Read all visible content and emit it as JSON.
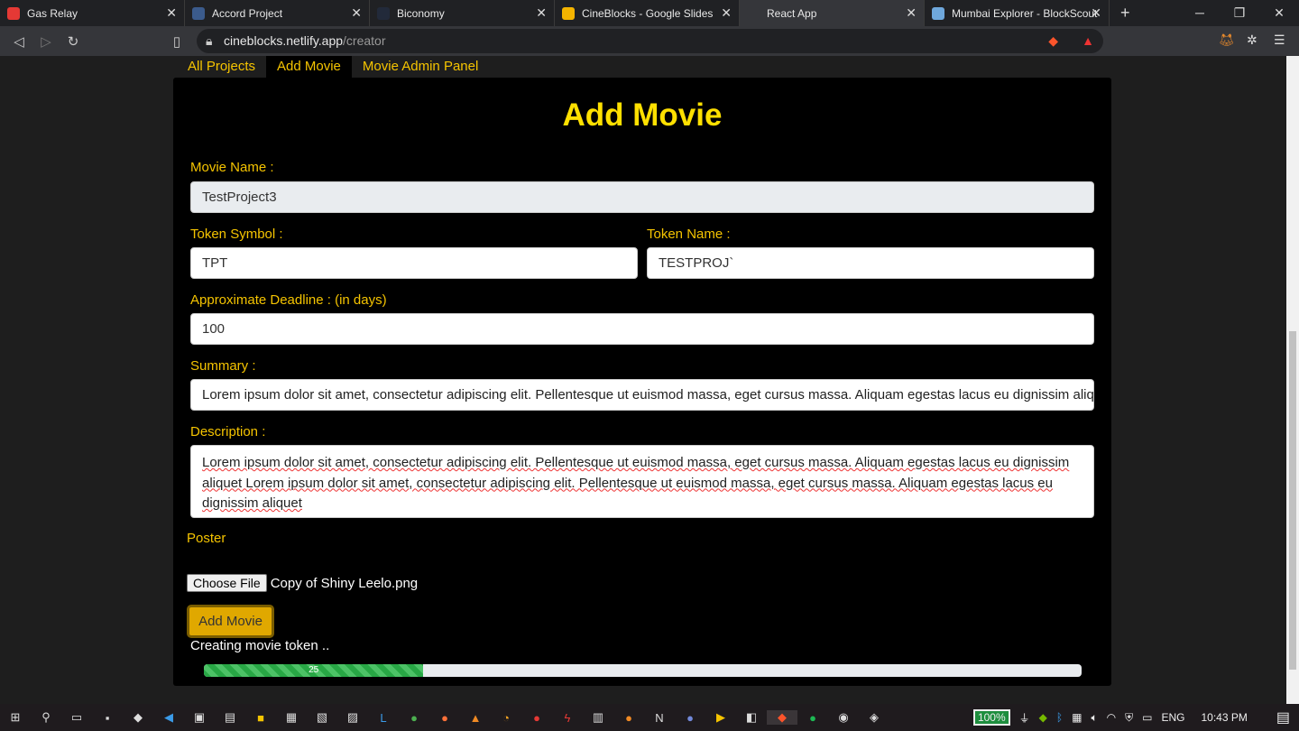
{
  "browser": {
    "tabs": [
      {
        "title": "Gas Relay",
        "color": "#e53935"
      },
      {
        "title": "Accord Project",
        "color": "#3b5b8c"
      },
      {
        "title": "Biconomy",
        "color": "#222a3a"
      },
      {
        "title": "CineBlocks - Google Slides",
        "color": "#f4b400"
      },
      {
        "title": "React App",
        "color": "#35363a",
        "active": true
      },
      {
        "title": "Mumbai Explorer - BlockScout",
        "color": "#6fa8dc"
      }
    ],
    "url_host": "cineblocks.netlify.app",
    "url_path": "/creator"
  },
  "nav": {
    "items": [
      "All Projects",
      "Add Movie",
      "Movie Admin Panel"
    ],
    "active": 1
  },
  "form": {
    "title": "Add Movie",
    "movie_name_label": "Movie Name :",
    "movie_name_value": "TestProject3",
    "token_symbol_label": "Token Symbol :",
    "token_symbol_value": "TPT",
    "token_name_label": "Token Name :",
    "token_name_value": "TESTPROJ`",
    "deadline_label": "Approximate Deadline : (in days)",
    "deadline_value": "100",
    "summary_label": "Summary :",
    "summary_value": "Lorem ipsum dolor sit amet, consectetur adipiscing elit. Pellentesque ut euismod massa, eget cursus massa. Aliquam egestas lacus eu dignissim aliquet",
    "description_label": "Description :",
    "description_value": "Lorem ipsum dolor sit amet, consectetur adipiscing elit. Pellentesque ut euismod massa, eget cursus massa. Aliquam egestas lacus eu dignissim aliquet Lorem ipsum dolor sit amet, consectetur adipiscing elit. Pellentesque ut euismod massa, eget cursus massa. Aliquam egestas lacus eu dignissim aliquet",
    "poster_label": "Poster",
    "choose_file_label": "Choose File",
    "file_name": "Copy of Shiny Leelo.png",
    "submit_label": "Add Movie",
    "status_text": "Creating movie token ..",
    "progress": 25,
    "progress_label": "25"
  },
  "taskbar": {
    "battery": "100%",
    "language": "ENG",
    "time": "10:43 PM"
  }
}
